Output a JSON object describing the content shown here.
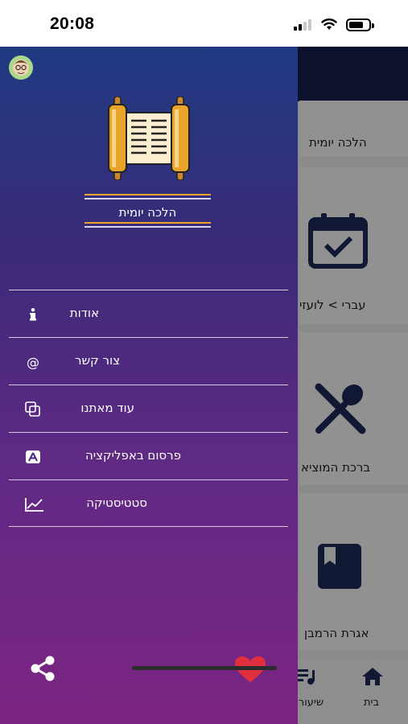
{
  "status_bar": {
    "time": "20:08",
    "battery_level": 0.65
  },
  "background_app": {
    "card_title": "הלכה יומית",
    "items": [
      {
        "label": "עברי  >  לועזי",
        "icon": "calendar-check-icon"
      },
      {
        "label": "ברכת המוציא",
        "icon": "fork-spoon-icon"
      },
      {
        "label": "אגרת הרמבן",
        "icon": "book-icon"
      }
    ],
    "nav": [
      {
        "label": "בית",
        "icon": "home-icon"
      },
      {
        "label": "שיעורי",
        "icon": "playlist-icon"
      }
    ]
  },
  "drawer": {
    "title": "הלכה  יומית",
    "logo": "torah-scroll-icon",
    "avatar": "avatar",
    "items": [
      {
        "label": "אודות",
        "icon": "info-icon"
      },
      {
        "label": "צור קשר",
        "icon": "at-icon"
      },
      {
        "label": "עוד מאתנו",
        "icon": "copy-icon"
      },
      {
        "label": "פרסום באפליקציה",
        "icon": "app-store-icon"
      },
      {
        "label": "סטטיסטיקה",
        "icon": "chart-line-icon"
      }
    ],
    "footer": {
      "share_icon": "share-icon",
      "favorite_icon": "heart-icon"
    },
    "colors": {
      "gradient_top": "#1f3a82",
      "gradient_bottom": "#7c2482",
      "gold": "#e8a52a",
      "heart": "#e03040"
    }
  }
}
